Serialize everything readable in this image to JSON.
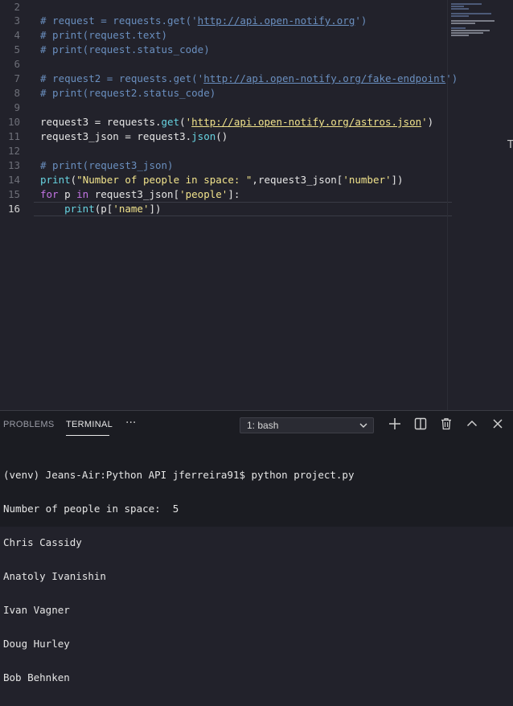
{
  "editor": {
    "line_numbers": [
      "2",
      "3",
      "4",
      "5",
      "6",
      "7",
      "8",
      "9",
      "10",
      "11",
      "12",
      "13",
      "14",
      "15",
      "16"
    ],
    "code": {
      "l3_a": "# request = requests.get('",
      "l3_url": "http://api.open-notify.org",
      "l3_b": "')",
      "l4": "# print(request.text)",
      "l5": "# print(request.status_code)",
      "l7_a": "# request2 = requests.get('",
      "l7_url": "http://api.open-notify.org/fake-endpoint",
      "l7_b": "')",
      "l8": "# print(request2.status_code)",
      "l10_a": "request3 = requests.",
      "l10_fn": "get",
      "l10_b": "(",
      "l10_q1": "'",
      "l10_url": "http://api.open-notify.org/astros.json",
      "l10_q2": "'",
      "l10_c": ")",
      "l11_a": "request3_json = request3.",
      "l11_fn": "json",
      "l11_b": "()",
      "l13": "# print(request3_json)",
      "l14_fn": "print",
      "l14_a": "(",
      "l14_str": "\"Number of people in space: \"",
      "l14_b": ",request3_json[",
      "l14_key": "'number'",
      "l14_c": "])",
      "l15_kw1": "for",
      "l15_a": " p ",
      "l15_kw2": "in",
      "l15_b": " request3_json[",
      "l15_key": "'people'",
      "l15_c": "]:",
      "l16_indent": "    ",
      "l16_fn": "print",
      "l16_a": "(p[",
      "l16_key": "'name'",
      "l16_b": "])"
    },
    "scroll_marker": "T"
  },
  "panel": {
    "tabs": {
      "problems": "PROBLEMS",
      "terminal": "TERMINAL",
      "more": "···"
    },
    "terminal_select": "1: bash",
    "terminal_output": [
      "(venv) Jeans-Air:Python API jferreira91$ python project.py",
      "Number of people in space:  5",
      "Chris Cassidy",
      "Anatoly Ivanishin",
      "Ivan Vagner",
      "Doug Hurley",
      "Bob Behnken"
    ]
  },
  "icons": [
    "add-icon",
    "split-icon",
    "trash-icon",
    "chevron-up-icon",
    "close-icon",
    "chevron-down-icon"
  ]
}
